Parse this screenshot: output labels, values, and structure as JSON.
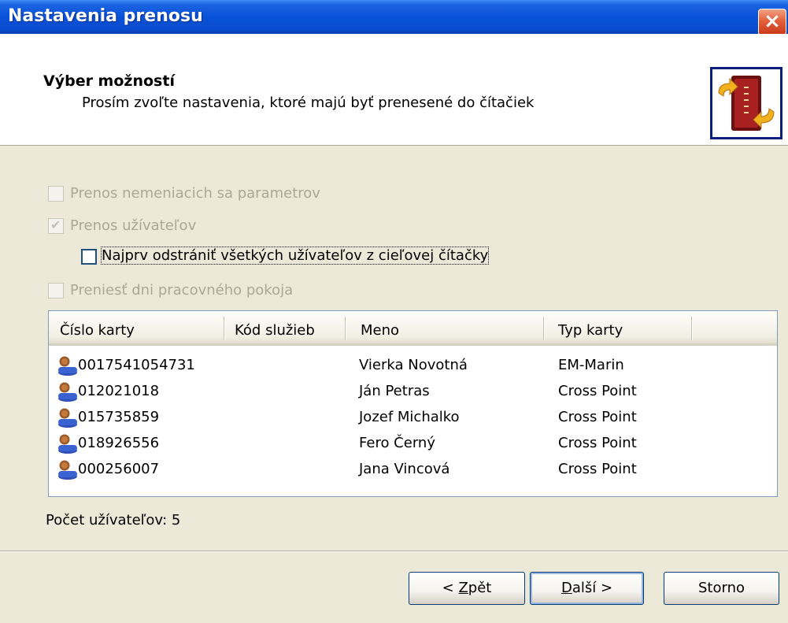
{
  "window": {
    "title": "Nastavenia prenosu",
    "close_glyph": "×"
  },
  "header": {
    "title": "Výber možností",
    "subtitle": "Prosím zvoľte nastavenia, ktoré majú byť prenesené do čítačiek",
    "logo_icon": "card-reader-transfer-icon"
  },
  "options": [
    {
      "label": "Prenos nemeniacich sa parametrov",
      "checked": false,
      "enabled": false
    },
    {
      "label": "Prenos užívateľov",
      "checked": true,
      "enabled": false
    },
    {
      "label": "Najprv odstrániť všetkých užívateľov z cieľovej čítačky",
      "checked": false,
      "enabled": true
    },
    {
      "label": "Preniesť dni pracovného pokoja",
      "checked": false,
      "enabled": false
    }
  ],
  "table": {
    "columns": [
      "Číslo karty",
      "Kód služieb",
      "Meno",
      "Typ karty"
    ],
    "rows": [
      {
        "card": "0017541054731",
        "service": "",
        "name": "Vierka Novotná",
        "type": "EM-Marin"
      },
      {
        "card": "012021018",
        "service": "",
        "name": "Ján Petras",
        "type": "Cross Point"
      },
      {
        "card": "015735859",
        "service": "",
        "name": "Jozef Michalko",
        "type": "Cross Point"
      },
      {
        "card": "018926556",
        "service": "",
        "name": "Fero Černý",
        "type": "Cross Point"
      },
      {
        "card": "000256007",
        "service": "",
        "name": "Jana Vincová",
        "type": "Cross Point"
      }
    ],
    "row_icon": "user-icon"
  },
  "count_label": "Počet užívateľov: 5",
  "buttons": {
    "back": {
      "prefix": "< ",
      "accel": "Z",
      "rest": "pět"
    },
    "next": {
      "accel": "D",
      "rest": "alší >"
    },
    "cancel": {
      "label": "Storno"
    }
  },
  "colors": {
    "titlebar": "#0852d8",
    "dialog_bg": "#ece9d8",
    "button_border": "#003c74",
    "close_button": "#e2613a"
  }
}
